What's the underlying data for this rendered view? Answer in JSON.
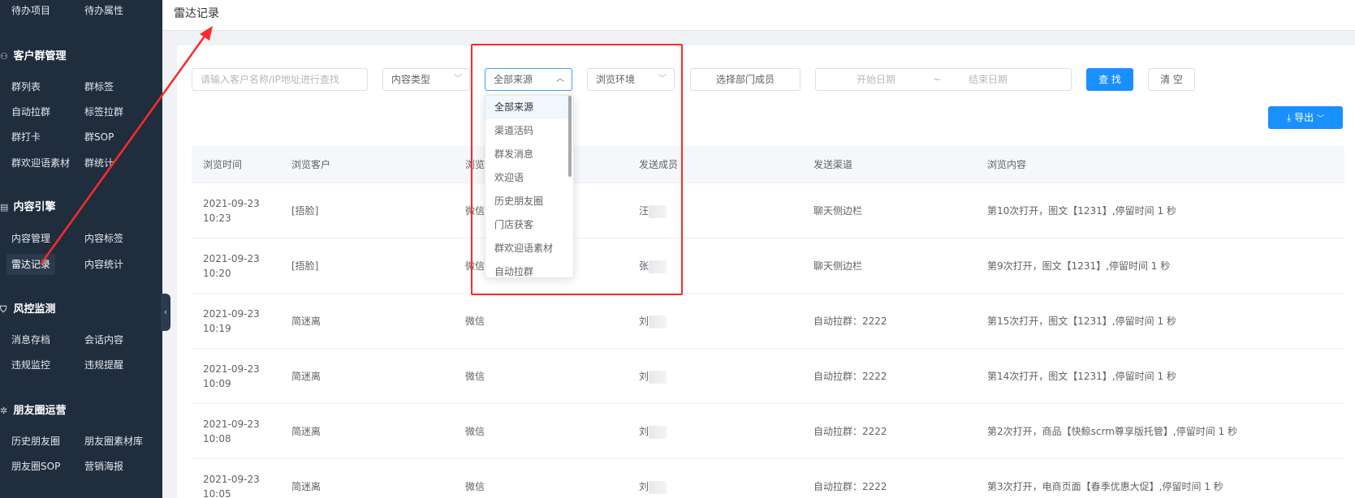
{
  "sidebar": {
    "top_items": [
      "待办项目",
      "待办属性"
    ],
    "groups": [
      {
        "icon": "group-icon",
        "title": "客户群管理",
        "items": [
          "群列表",
          "群标签",
          "自动拉群",
          "标签拉群",
          "群打卡",
          "群SOP",
          "群欢迎语素材",
          "群统计"
        ]
      },
      {
        "icon": "content-icon",
        "title": "内容引擎",
        "items": [
          "内容管理",
          "内容标签",
          "雷达记录",
          "内容统计"
        ]
      },
      {
        "icon": "shield-icon",
        "title": "风控监测",
        "items": [
          "消息存档",
          "会话内容",
          "违规监控",
          "违规提醒"
        ]
      },
      {
        "icon": "moments-icon",
        "title": "朋友圈运营",
        "items": [
          "历史朋友圈",
          "朋友圈素材库",
          "朋友圈SOP",
          "营销海报"
        ]
      }
    ],
    "active_item": "雷达记录"
  },
  "header": {
    "title": "雷达记录"
  },
  "filters": {
    "search_placeholder": "请输入客户名称/IP地址进行查找",
    "content_type": "内容类型",
    "source": "全部来源",
    "env": "浏览环境",
    "member": "选择部门成员",
    "start_date": "开始日期",
    "separator": "~",
    "end_date": "结束日期",
    "search_btn": "查 找",
    "clear_btn": "清 空",
    "export_btn": "导出"
  },
  "dropdown": {
    "options": [
      "全部来源",
      "渠道活码",
      "群发消息",
      "欢迎语",
      "历史朋友圈",
      "门店获客",
      "群欢迎语素材",
      "自动拉群"
    ],
    "selected": "全部来源"
  },
  "table": {
    "columns": [
      "浏览时间",
      "浏览客户",
      "浏览",
      "发送成员",
      "发送渠道",
      "浏览内容"
    ],
    "rows": [
      {
        "date": "2021-09-23",
        "time": "10:23",
        "customer": "[捂脸]",
        "env": "微信",
        "member": "汪",
        "channel": "聊天侧边栏",
        "content": "第10次打开，图文【1231】,停留时间 1 秒"
      },
      {
        "date": "2021-09-23",
        "time": "10:20",
        "customer": "[捂脸]",
        "env": "微信",
        "member": "张",
        "channel": "聊天侧边栏",
        "content": "第9次打开，图文【1231】,停留时间 1 秒"
      },
      {
        "date": "2021-09-23",
        "time": "10:19",
        "customer": "简迷离",
        "env": "微信",
        "member": "刘",
        "channel": "自动拉群：2222",
        "content": "第15次打开，图文【1231】,停留时间 1 秒"
      },
      {
        "date": "2021-09-23",
        "time": "10:09",
        "customer": "简迷离",
        "env": "微信",
        "member": "刘",
        "channel": "自动拉群：2222",
        "content": "第14次打开，图文【1231】,停留时间 1 秒"
      },
      {
        "date": "2021-09-23",
        "time": "10:08",
        "customer": "简迷离",
        "env": "微信",
        "member": "刘",
        "channel": "自动拉群：2222",
        "content": "第2次打开，商品【快鲸scrm尊享版托管】,停留时间 1 秒"
      },
      {
        "date": "2021-09-23",
        "time": "10:05",
        "customer": "简迷离",
        "env": "微信",
        "member": "刘",
        "channel": "自动拉群：2222",
        "content": "第3次打开，电商页面【春季优惠大促】,停留时间 1 秒"
      }
    ]
  },
  "colors": {
    "sidebar_bg": "#1f2d3d",
    "primary": "#1890ff",
    "annotation": "#ff2a2a"
  }
}
